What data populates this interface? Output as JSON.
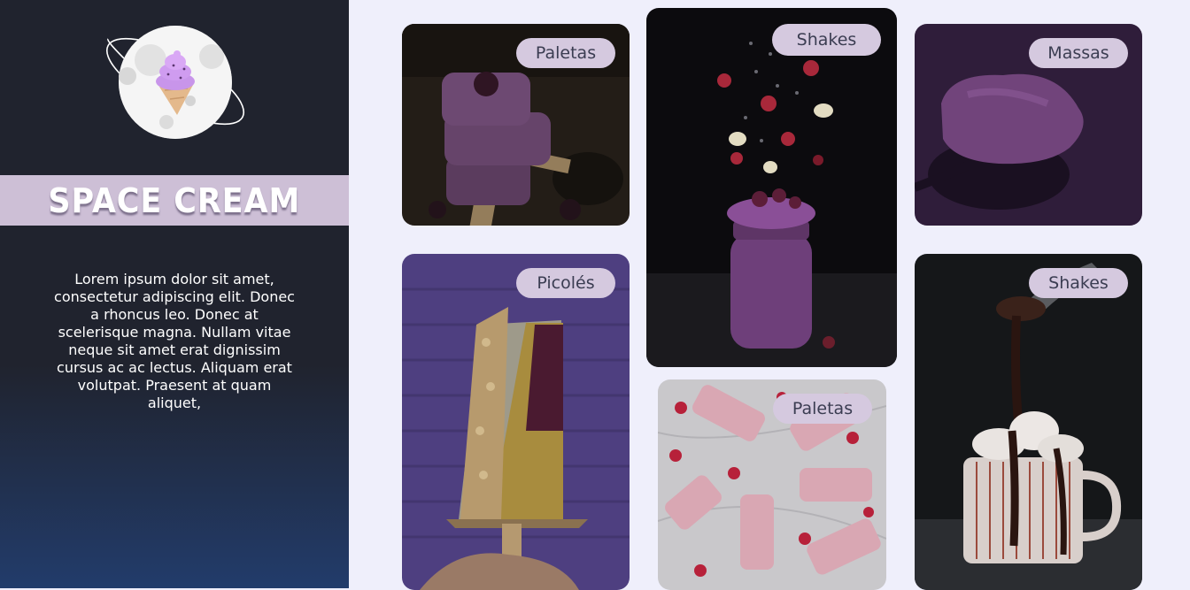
{
  "brand": {
    "title": "SPACE CREAM",
    "logo_icon": "planet-ice-cream-logo-icon"
  },
  "intro_text": "Lorem ipsum dolor sit amet, consectetur adipiscing elit. Donec a rhoncus leo. Donec at scelerisque magna. Nullam vitae neque sit amet erat dignissim cursus ac ac lectus. Aliquam erat volutpat. Praesent at quam aliquet,",
  "colors": {
    "sidebar": "#20232e",
    "sidebar_gradient_end": "#223c6b",
    "brand_band": "#cdbfd6",
    "page_background": "#efeffb",
    "tag_background": "#d5c9df",
    "tag_text": "#3b3d52"
  },
  "cards": [
    {
      "label": "Paletas",
      "image": "stacked-berry-popsicles-photo"
    },
    {
      "label": "Shakes",
      "image": "berry-shake-jar-photo"
    },
    {
      "label": "Massas",
      "image": "ice-cream-scoop-photo"
    },
    {
      "label": "Picolés",
      "image": "nut-topped-popsicle-photo"
    },
    {
      "label": "Paletas",
      "image": "raspberry-popsicles-on-marble-photo"
    },
    {
      "label": "Shakes",
      "image": "hot-chocolate-mug-photo"
    }
  ]
}
